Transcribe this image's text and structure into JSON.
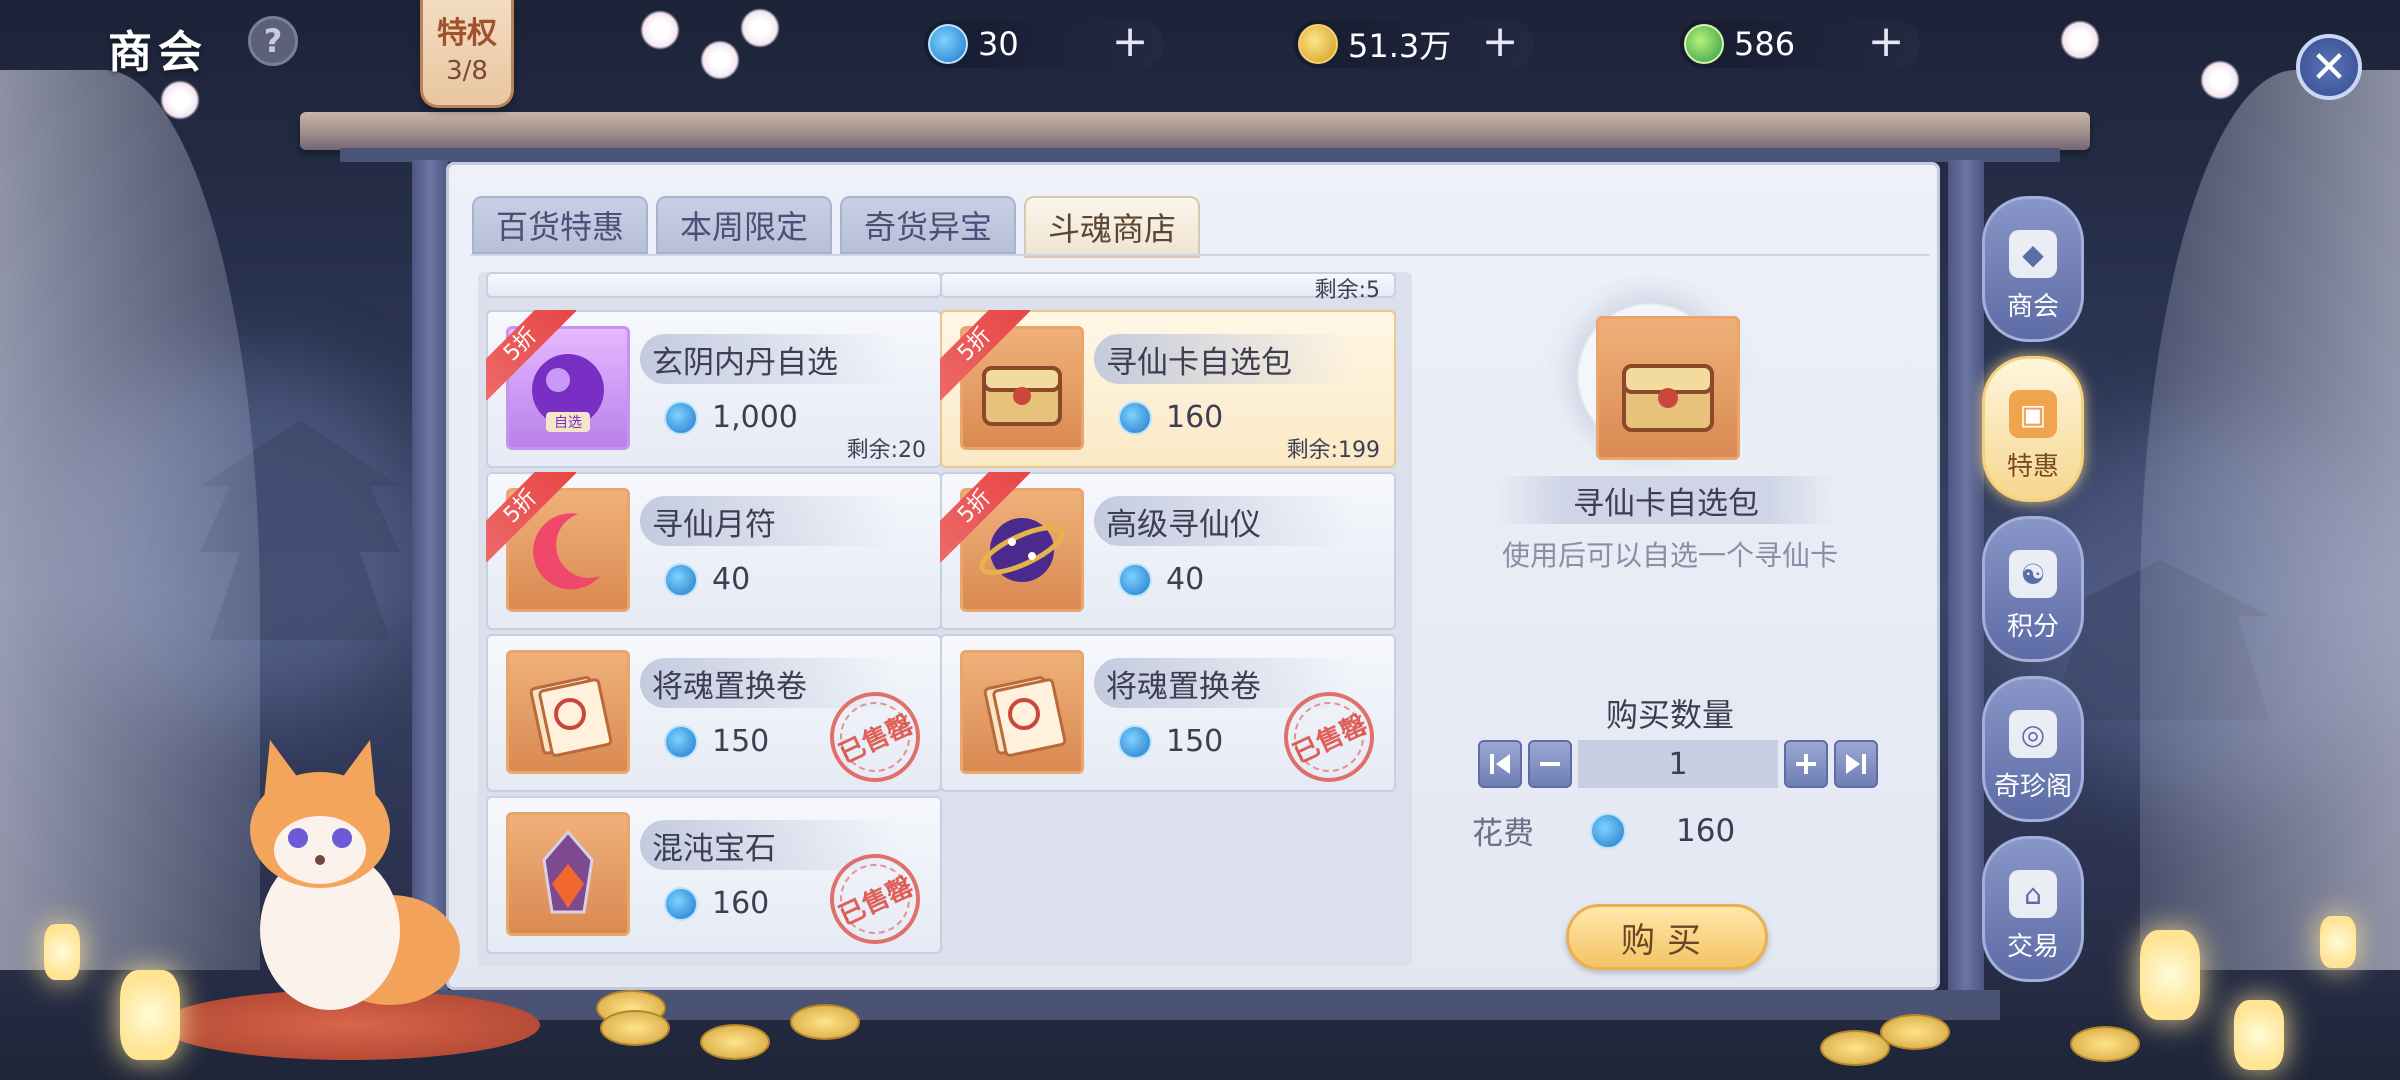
{
  "header": {
    "title": "商会",
    "help_label": "?",
    "privilege": {
      "label": "特权",
      "progress": "3/8"
    }
  },
  "resources": [
    {
      "icon": "jade-currency-icon",
      "value": "30",
      "plus": "+"
    },
    {
      "icon": "gold-coin-icon",
      "value": "51.3万",
      "plus": "+"
    },
    {
      "icon": "green-gem-icon",
      "value": "586",
      "plus": "+"
    }
  ],
  "close_label": "✕",
  "tabs": [
    {
      "label": "百货特惠",
      "active": false
    },
    {
      "label": "本周限定",
      "active": false
    },
    {
      "label": "奇货异宝",
      "active": false
    },
    {
      "label": "斗魂商店",
      "active": true
    }
  ],
  "partial_row": {
    "remain": "剩余:5"
  },
  "items": [
    {
      "name": "玄阴内丹自选",
      "price": "1,000",
      "remain": "剩余:20",
      "discount": "5折",
      "sold_out": false,
      "tag": "自选"
    },
    {
      "name": "寻仙卡自选包",
      "price": "160",
      "remain": "剩余:199",
      "discount": "5折",
      "sold_out": false,
      "selected": true
    },
    {
      "name": "寻仙月符",
      "price": "40",
      "remain": "",
      "discount": "5折",
      "sold_out": false
    },
    {
      "name": "高级寻仙仪",
      "price": "40",
      "remain": "",
      "discount": "5折",
      "sold_out": false
    },
    {
      "name": "将魂置换卷",
      "price": "150",
      "remain": "",
      "discount": "",
      "sold_out": true
    },
    {
      "name": "将魂置换卷",
      "price": "150",
      "remain": "",
      "discount": "",
      "sold_out": true
    },
    {
      "name": "混沌宝石",
      "price": "160",
      "remain": "",
      "discount": "",
      "sold_out": true
    }
  ],
  "sold_out_label": "已售罄",
  "detail": {
    "name": "寻仙卡自选包",
    "description": "使用后可以自选一个寻仙卡",
    "qty_title": "购买数量",
    "qty_value": "1",
    "cost_label": "花费",
    "cost_value": "160",
    "buy_label": "购买"
  },
  "sidenav": [
    {
      "label": "商会",
      "icon": "cat-icon",
      "active": false
    },
    {
      "label": "特惠",
      "icon": "gift-icon",
      "active": true
    },
    {
      "label": "积分",
      "icon": "yin-yang-icon",
      "active": false
    },
    {
      "label": "奇珍阁",
      "icon": "treasure-icon",
      "active": false
    },
    {
      "label": "交易",
      "icon": "stall-icon",
      "active": false
    }
  ],
  "colors": {
    "jade": "#1f78c9",
    "gold": "#d19a1f",
    "discount_red": "#e84444",
    "sold_stamp": "#dc463c",
    "selected_bg": "#fbe9c6"
  }
}
